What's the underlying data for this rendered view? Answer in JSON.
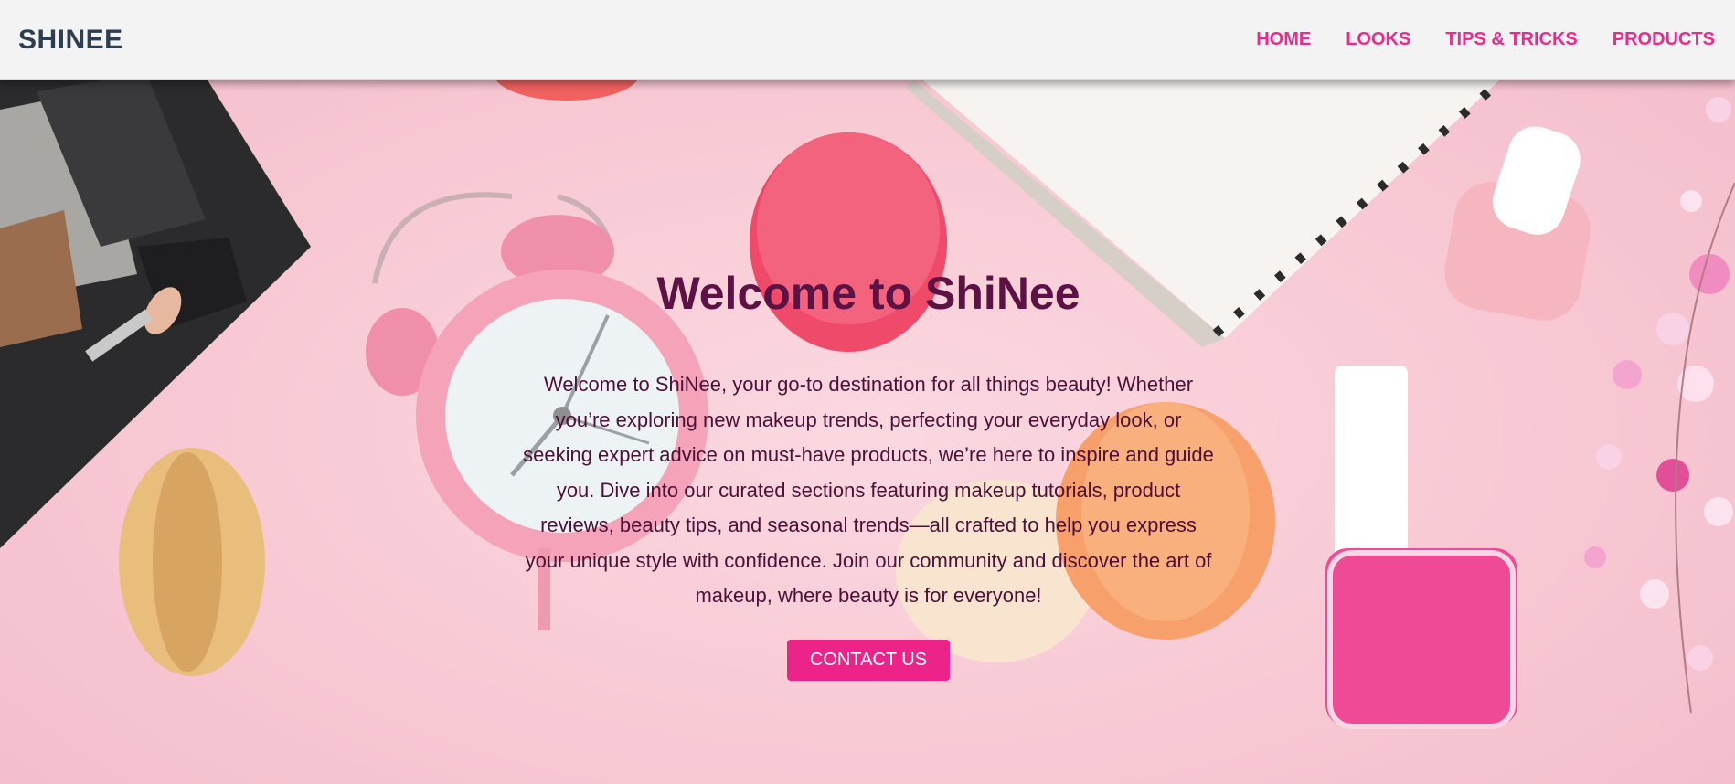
{
  "navbar": {
    "brand": "SHINEE",
    "links": [
      {
        "label": "HOME"
      },
      {
        "label": "LOOKS"
      },
      {
        "label": "TIPS & TRICKS"
      },
      {
        "label": "PRODUCTS"
      }
    ]
  },
  "hero": {
    "title": "Welcome to ShiNee",
    "description": "Welcome to ShiNee, your go-to destination for all things beauty! Whether you’re exploring new makeup trends, perfecting your everyday look, or seeking expert advice on must-have products, we’re here to inspire and guide you. Dive into our curated sections featuring makeup tutorials, product reviews, beauty tips, and seasonal trends—all crafted to help you express your unique style with confidence. Join our community and discover the art of makeup, where beauty is for everyone!",
    "cta_label": "CONTACT US"
  },
  "colors": {
    "accent": "#ec2388",
    "brand_text": "#2d3e50",
    "hero_text": "#5a1140",
    "background": "#f7c9d3"
  }
}
